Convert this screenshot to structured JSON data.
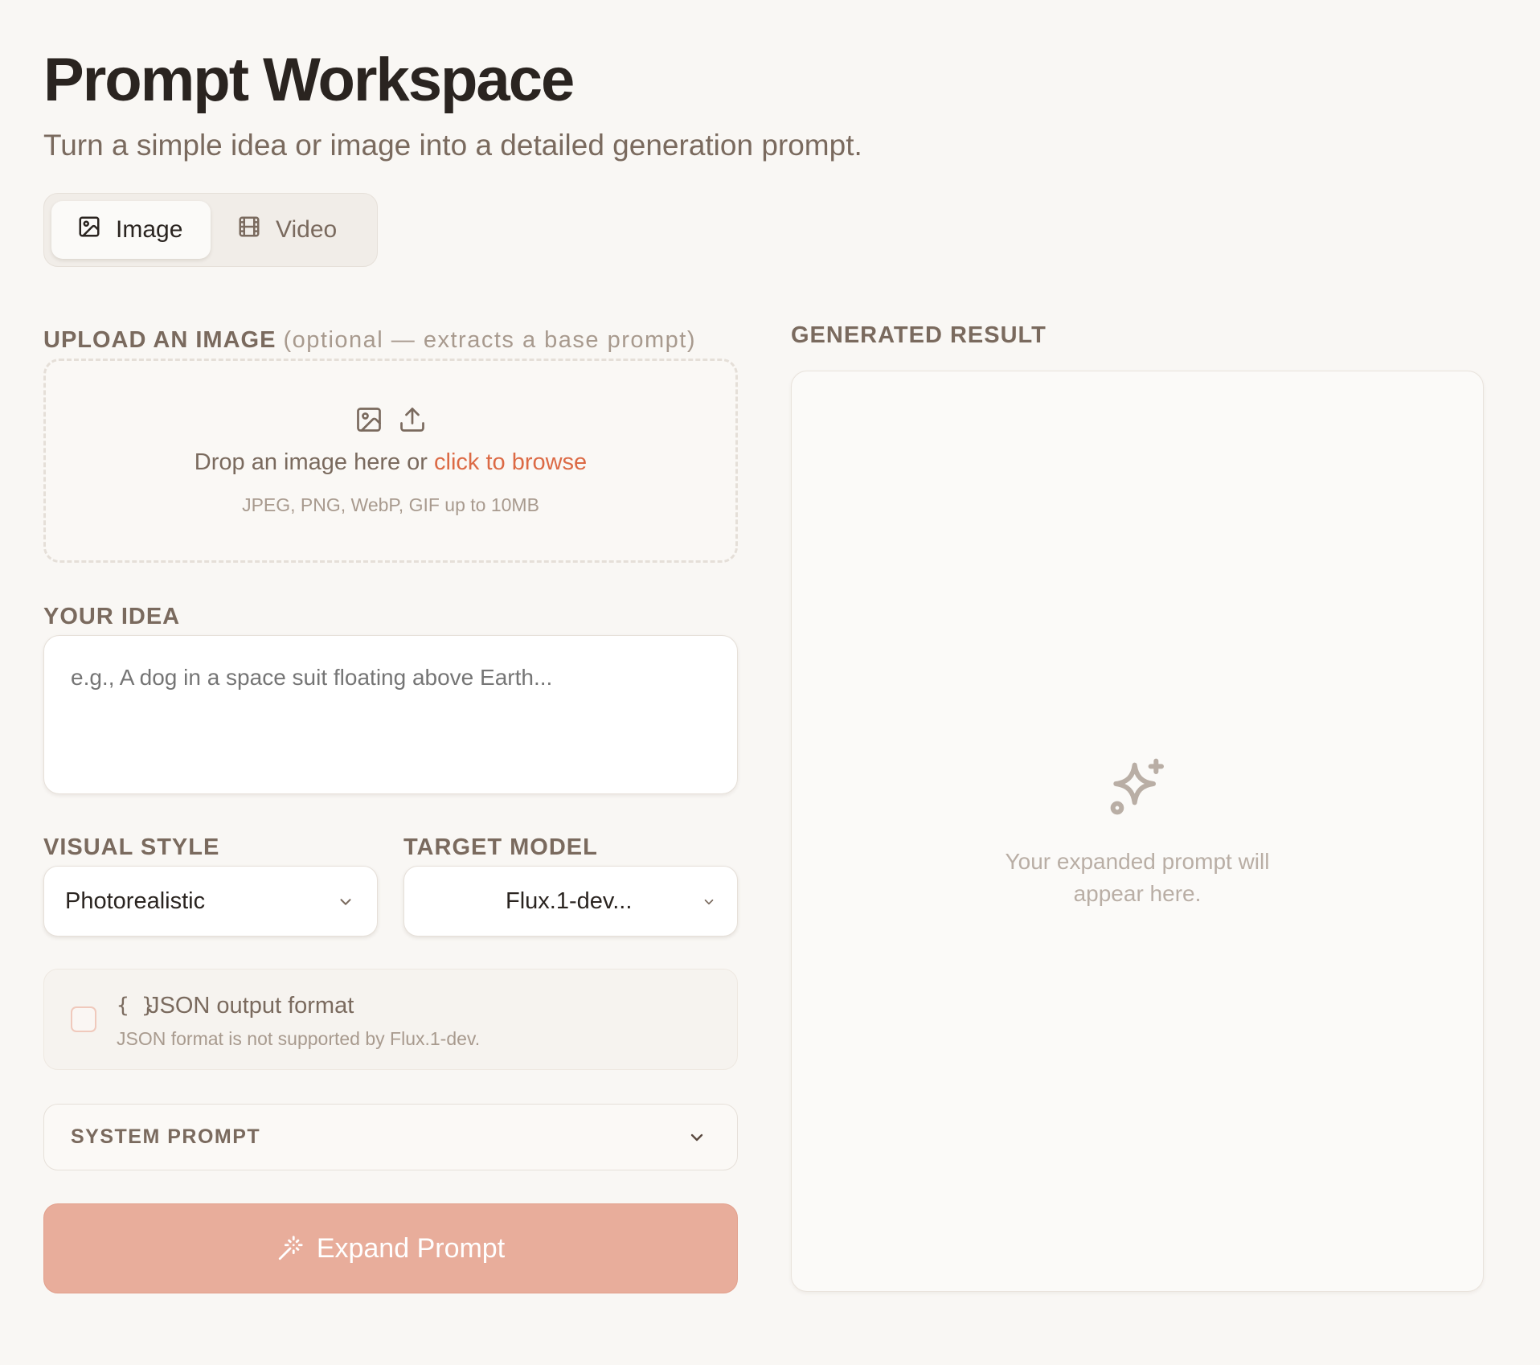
{
  "header": {
    "title": "Prompt Workspace",
    "subtitle": "Turn a simple idea or image into a detailed generation prompt."
  },
  "mode_toggle": {
    "image_label": "Image",
    "video_label": "Video",
    "selected": "Image"
  },
  "upload": {
    "label": "UPLOAD AN IMAGE",
    "label_note": "(optional — extracts a base prompt)",
    "drop_text": "Drop an image here or",
    "browse_link": "click to browse",
    "hint": "JPEG, PNG, WebP, GIF up to 10MB"
  },
  "idea": {
    "label": "YOUR IDEA",
    "placeholder": "e.g., A dog in a space suit floating above Earth...",
    "value": ""
  },
  "visual_style": {
    "label": "VISUAL STYLE",
    "value": "Photorealistic"
  },
  "target_model": {
    "label": "TARGET MODEL",
    "value": "Flux.1-dev..."
  },
  "json_option": {
    "braces": "{ }",
    "title": "JSON output format",
    "note": "JSON format is not supported by Flux.1-dev.",
    "checked": false
  },
  "system_prompt": {
    "label": "SYSTEM PROMPT"
  },
  "expand_button": {
    "label": "Expand Prompt"
  },
  "result": {
    "label": "GENERATED RESULT",
    "placeholder": "Your expanded prompt will appear here."
  },
  "colors": {
    "background": "#f9f7f4",
    "accent": "#dc6a45",
    "button_disabled": "#e8ad9b",
    "text_muted": "#7a6a5e"
  }
}
